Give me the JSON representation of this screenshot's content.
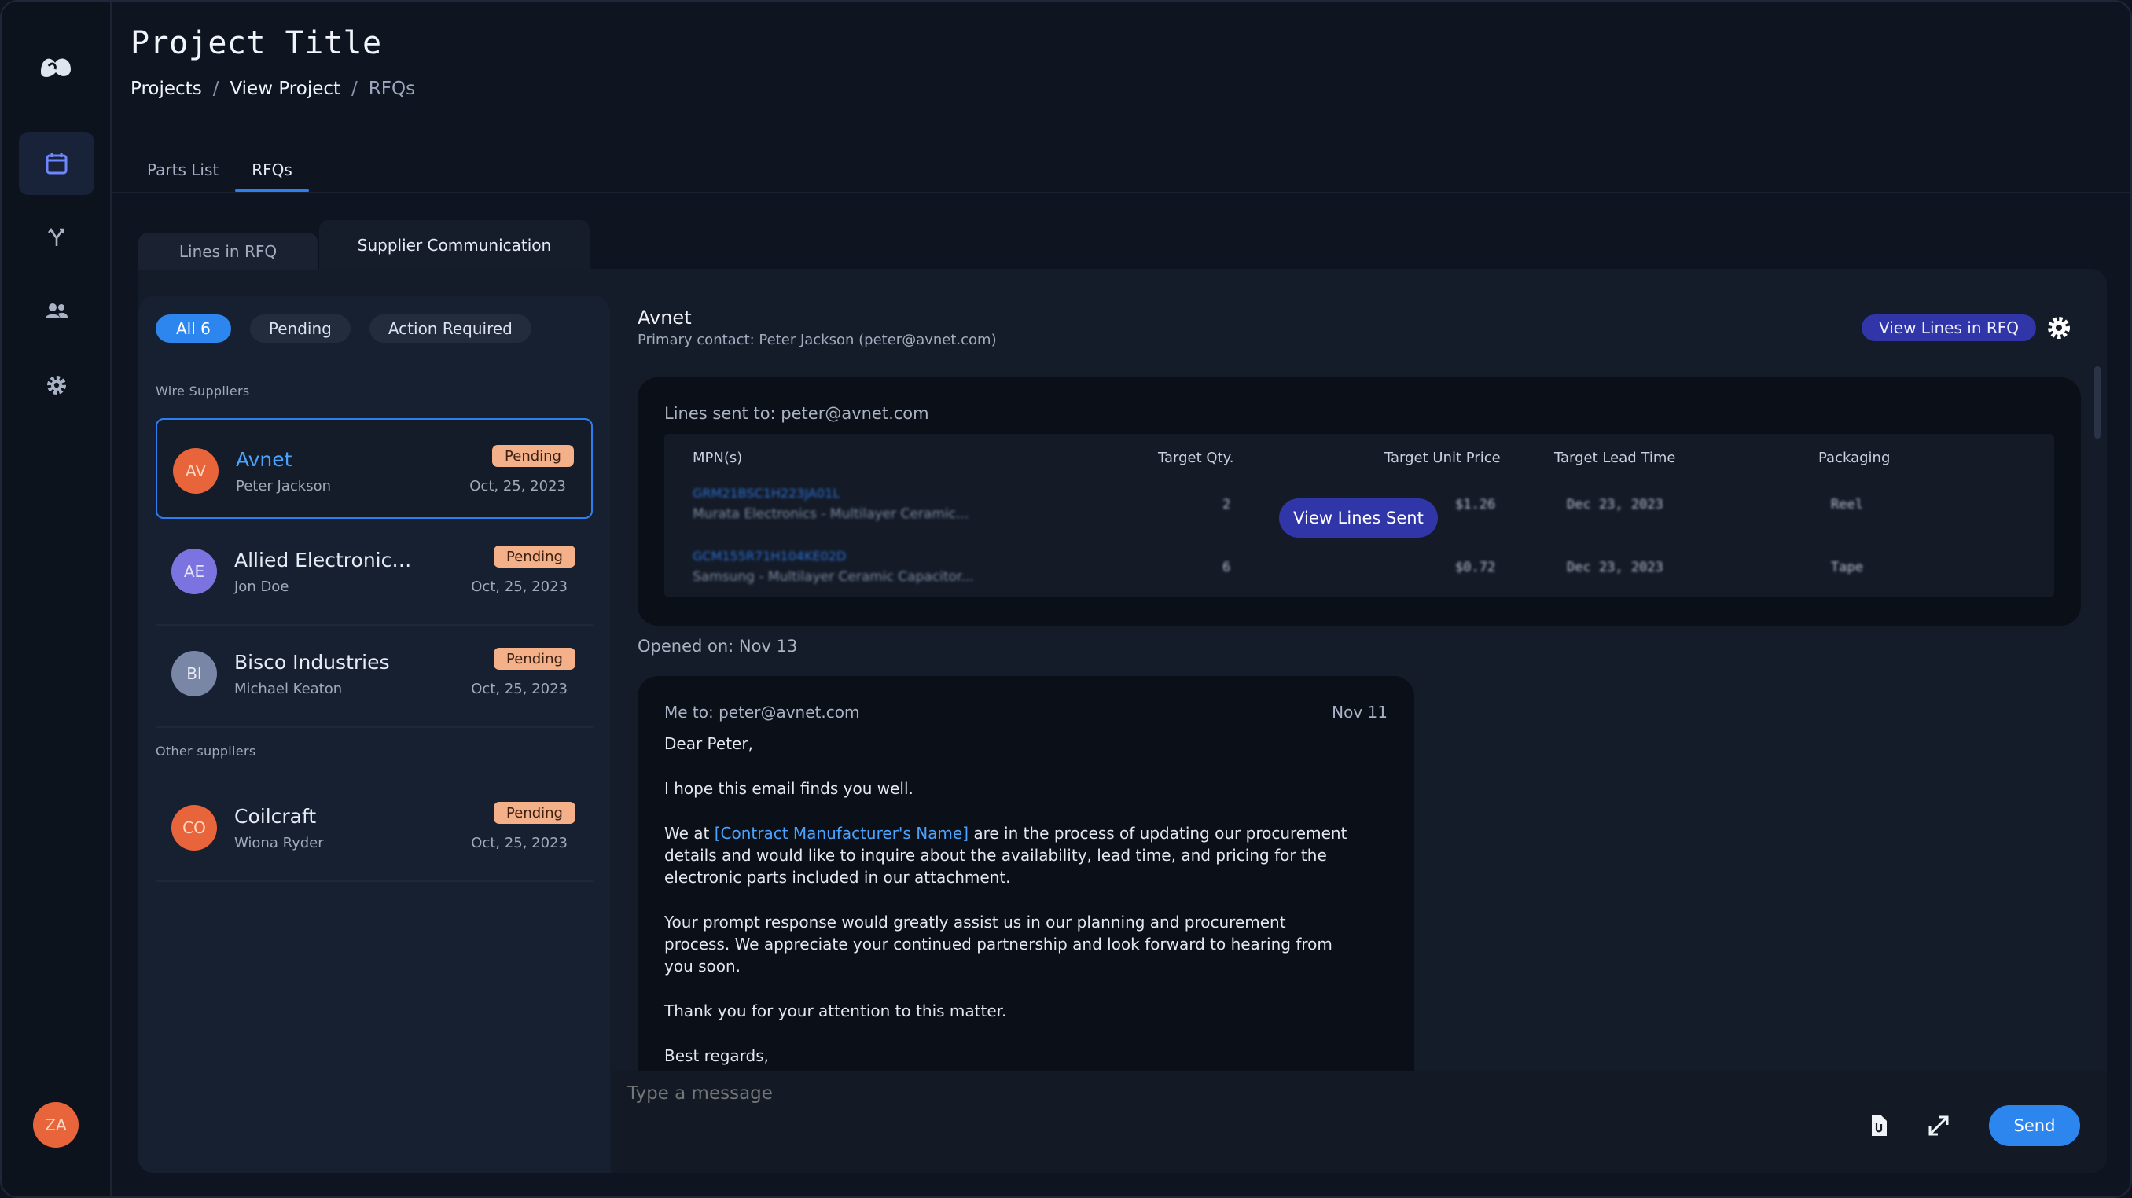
{
  "header": {
    "title": "Project Title",
    "breadcrumbs": [
      "Projects",
      "View Project",
      "RFQs"
    ],
    "breadcrumb_sep": "/"
  },
  "rail": {
    "items": [
      {
        "icon": "calendar-icon",
        "active": true
      },
      {
        "icon": "merge-icon",
        "active": false
      },
      {
        "icon": "users-icon",
        "active": false
      },
      {
        "icon": "gear-icon",
        "active": false
      }
    ],
    "user_initials": "ZA"
  },
  "tabs": [
    "Parts List",
    "RFQs"
  ],
  "sub_tabs": [
    "Lines in RFQ",
    "Supplier Communication"
  ],
  "filters": {
    "all": "All 6",
    "pending": "Pending",
    "action_required": "Action Required"
  },
  "groups": {
    "wire": "Wire Suppliers",
    "other": "Other suppliers"
  },
  "suppliers": [
    {
      "initials": "AV",
      "name": "Avnet",
      "contact": "Peter Jackson",
      "status": "Pending",
      "date": "Oct, 25, 2023",
      "color": "#e8643a"
    },
    {
      "initials": "AE",
      "name": "Allied Electronics, I...",
      "contact": "Jon Doe",
      "status": "Pending",
      "date": "Oct, 25, 2023",
      "color": "#7b74e0"
    },
    {
      "initials": "BI",
      "name": "Bisco Industries",
      "contact": "Michael Keaton",
      "status": "Pending",
      "date": "Oct, 25, 2023",
      "color": "#7a86a6"
    },
    {
      "initials": "CO",
      "name": "Coilcraft",
      "contact": "Wiona Ryder",
      "status": "Pending",
      "date": "Oct, 25, 2023",
      "color": "#e8643a"
    }
  ],
  "detail": {
    "name": "Avnet",
    "primary_contact": "Primary contact: Peter Jackson (peter@avnet.com)",
    "view_lines_btn": "View Lines in RFQ",
    "lines_sent_to": "Lines sent to: peter@avnet.com",
    "columns": [
      "MPN(s)",
      "Target Qty.",
      "Target Unit Price",
      "Target Lead Time",
      "Packaging"
    ],
    "rows": [
      {
        "mpn": "GRM21BSC1H223JA01L",
        "desc": "Murata Electronics - Multilayer Ceramic...",
        "qty": "2",
        "price": "$1.26",
        "lead": "Dec 23, 2023",
        "pack": "Reel"
      },
      {
        "mpn": "GCM155R71H104KE02D",
        "desc": "Samsung - Multilayer Ceramic Capacitor...",
        "qty": "6",
        "price": "$0.72",
        "lead": "Dec 23, 2023",
        "pack": "Tape"
      }
    ],
    "view_lines_sent_btn": "View Lines Sent",
    "opened_on": "Opened on: Nov 13"
  },
  "email": {
    "from": "Me to: peter@avnet.com",
    "date": "Nov 11",
    "greeting": "Dear Peter,",
    "p1": "I hope this email finds you well.",
    "p2_pre": "We at ",
    "p2_link": "[Contract Manufacturer's Name]",
    "p2_post": " are in the process of updating our procurement details and would like to inquire about the availability, lead time, and pricing for the electronic parts included in our attachment.",
    "p3": "Your prompt response would greatly assist us in our planning and procurement process. We appreciate your continued partnership and look forward to hearing from you soon.",
    "p4": "Thank you for your attention to this matter.",
    "closing": "Best regards,"
  },
  "composer": {
    "placeholder": "Type a message",
    "send": "Send"
  }
}
